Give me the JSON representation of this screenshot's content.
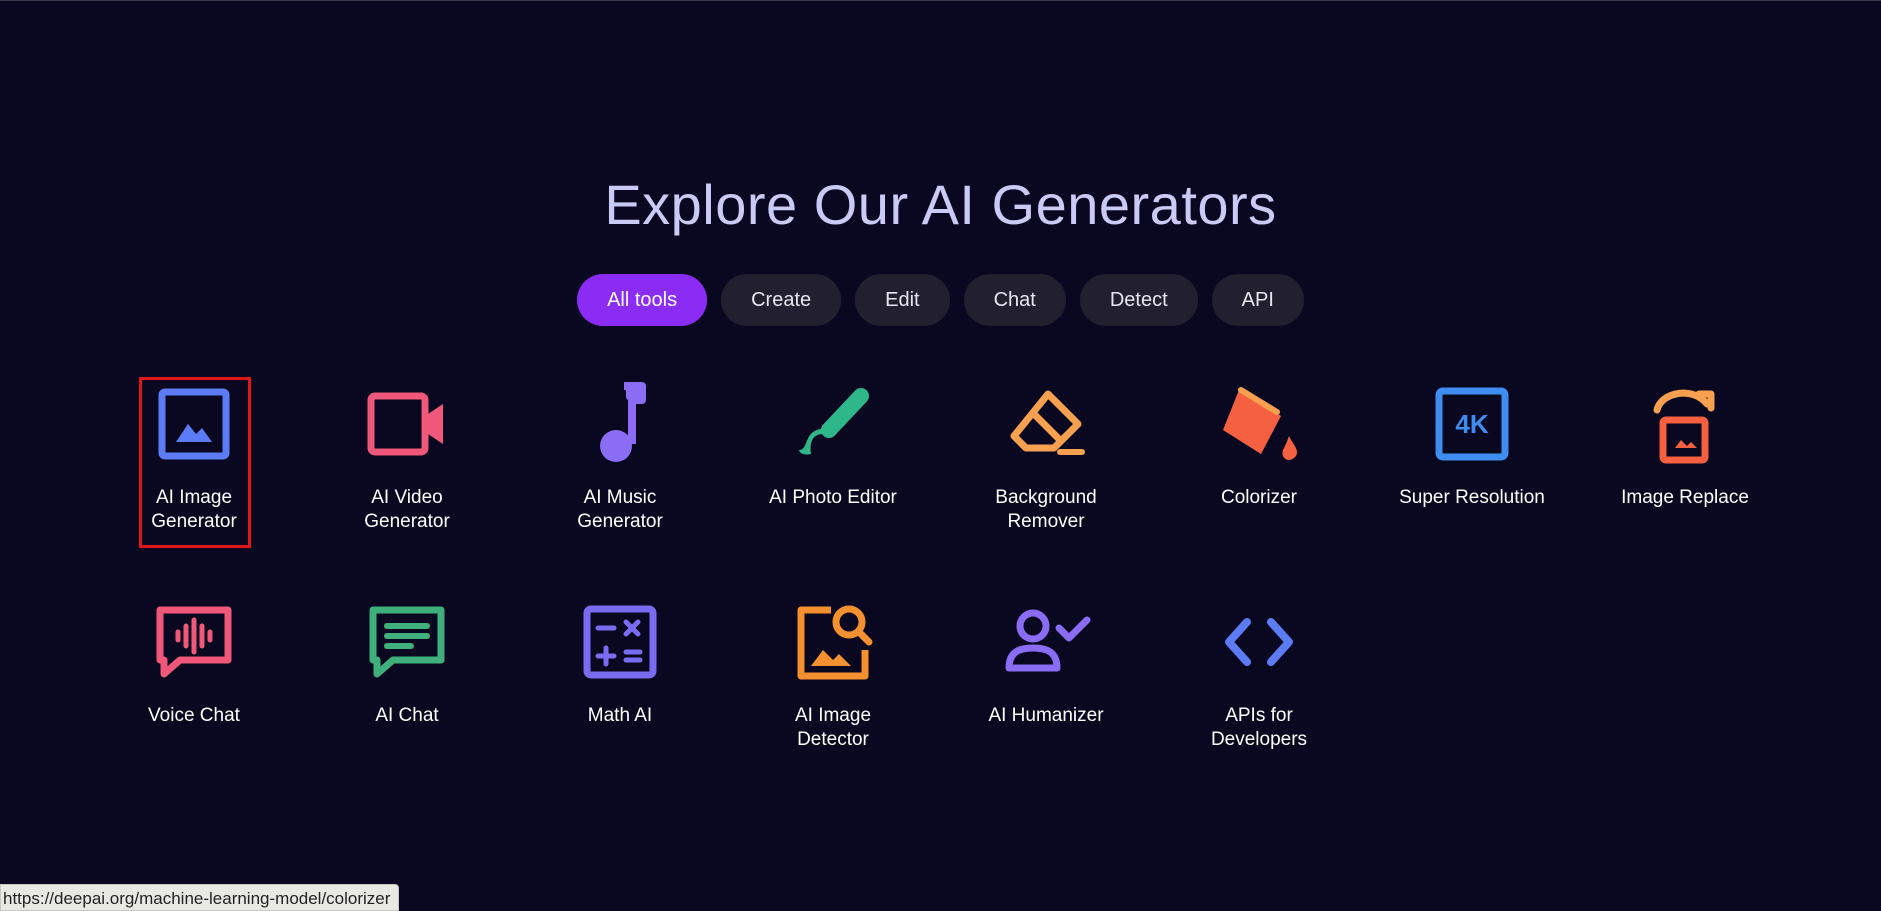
{
  "title": "Explore Our AI Generators",
  "tabs": [
    {
      "label": "All tools",
      "active": true
    },
    {
      "label": "Create",
      "active": false
    },
    {
      "label": "Edit",
      "active": false
    },
    {
      "label": "Chat",
      "active": false
    },
    {
      "label": "Detect",
      "active": false
    },
    {
      "label": "API",
      "active": false
    }
  ],
  "tools": [
    {
      "label": "AI Image\nGenerator",
      "icon": "image-icon",
      "color": "#5b7cf5"
    },
    {
      "label": "AI Video\nGenerator",
      "icon": "video-camera-icon",
      "color": "#f0587a"
    },
    {
      "label": "AI Music\nGenerator",
      "icon": "music-note-icon",
      "color": "#8a6cf5"
    },
    {
      "label": "AI Photo Editor",
      "icon": "paintbrush-icon",
      "color": "#2eb88a"
    },
    {
      "label": "Background\nRemover",
      "icon": "eraser-icon",
      "color": "#f7a050"
    },
    {
      "label": "Colorizer",
      "icon": "paint-bucket-icon",
      "color": "#f56040"
    },
    {
      "label": "Super Resolution",
      "icon": "4k-icon",
      "color": "#3d8ef0"
    },
    {
      "label": "Image Replace",
      "icon": "image-replace-icon",
      "color": "#f77040"
    },
    {
      "label": "Voice Chat",
      "icon": "voice-chat-icon",
      "color": "#f0587a"
    },
    {
      "label": "AI Chat",
      "icon": "chat-bubble-icon",
      "color": "#3fb07c"
    },
    {
      "label": "Math AI",
      "icon": "calculator-icon",
      "color": "#7a6cf0"
    },
    {
      "label": "AI Image\nDetector",
      "icon": "image-search-icon",
      "color": "#f59030"
    },
    {
      "label": "AI Humanizer",
      "icon": "user-check-icon",
      "color": "#8a6cf5"
    },
    {
      "label": "APIs for\nDevelopers",
      "icon": "code-icon",
      "color": "#5b7cf5"
    }
  ],
  "status": {
    "url": "https://deepai.org/machine-learning-model/colorizer"
  }
}
